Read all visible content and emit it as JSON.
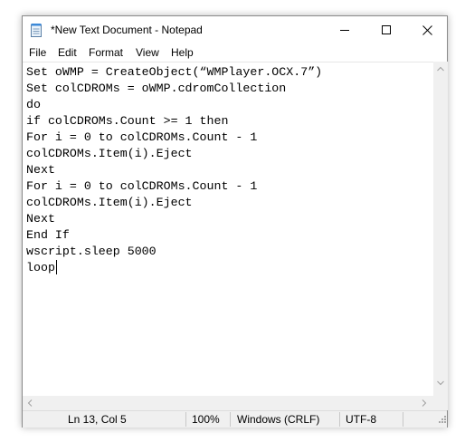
{
  "window": {
    "title": "*New Text Document - Notepad",
    "controls": {
      "minimize": "minimize",
      "maximize": "maximize",
      "close": "close"
    }
  },
  "menu": {
    "items": [
      {
        "label": "File"
      },
      {
        "label": "Edit"
      },
      {
        "label": "Format"
      },
      {
        "label": "View"
      },
      {
        "label": "Help"
      }
    ]
  },
  "editor": {
    "lines": [
      "Set oWMP = CreateObject(“WMPlayer.OCX.7”)",
      "Set colCDROMs = oWMP.cdromCollection",
      "do",
      "if colCDROMs.Count >= 1 then",
      "For i = 0 to colCDROMs.Count - 1",
      "colCDROMs.Item(i).Eject",
      "Next",
      "For i = 0 to colCDROMs.Count - 1",
      "colCDROMs.Item(i).Eject",
      "Next",
      "End If",
      "wscript.sleep 5000",
      "loop"
    ]
  },
  "status": {
    "position": "Ln 13, Col 5",
    "zoom": "100%",
    "line_ending": "Windows (CRLF)",
    "encoding": "UTF-8"
  },
  "icons": [
    "notepad-app-icon",
    "minimize-icon",
    "maximize-icon",
    "close-icon",
    "chevron-up-icon",
    "chevron-down-icon",
    "chevron-left-icon",
    "chevron-right-icon",
    "resize-grip-icon"
  ],
  "colors": {
    "window_bg": "#ffffff",
    "chrome_bg": "#f0f0f0",
    "border": "#8a8a8a",
    "text": "#000000"
  }
}
